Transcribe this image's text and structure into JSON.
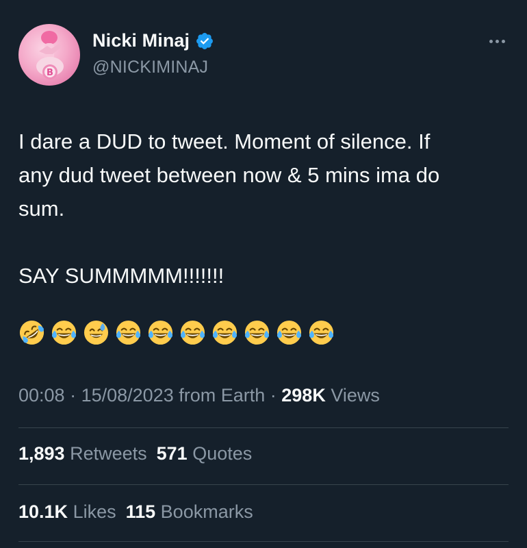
{
  "author": {
    "name": "Nicki Minaj",
    "handle": "@NICKIMINAJ",
    "verified": true,
    "avatar_icon": "pink-avatar-icon"
  },
  "more_icon": "more-options-icon",
  "tweet": {
    "lines": [
      "I dare a DUD to tweet. Moment of silence. If",
      "any dud tweet between now & 5 mins ima do",
      "sum."
    ],
    "shout": "SAY SUMMMMM!!!!!!!",
    "emojis": [
      "rolling-on-floor-laughing",
      "tears-of-joy",
      "grinning-sweat",
      "tears-of-joy",
      "tears-of-joy",
      "tears-of-joy",
      "tears-of-joy",
      "tears-of-joy",
      "tears-of-joy",
      "tears-of-joy"
    ]
  },
  "meta": {
    "time": "00:08",
    "sep1": " · ",
    "date": "15/08/2023",
    "source": " from Earth",
    "sep2": " · ",
    "views_count": "298K",
    "views_label": " Views"
  },
  "stats": {
    "retweets_count": "1,893",
    "retweets_label": " Retweets",
    "quotes_count": "571",
    "quotes_label": " Quotes",
    "likes_count": "10.1K",
    "likes_label": " Likes",
    "bookmarks_count": "115",
    "bookmarks_label": " Bookmarks"
  },
  "colors": {
    "background": "#15202b",
    "text": "#f7f9f9",
    "secondary": "#8b98a5",
    "verified": "#1d9bf0",
    "divider": "#38444d"
  }
}
